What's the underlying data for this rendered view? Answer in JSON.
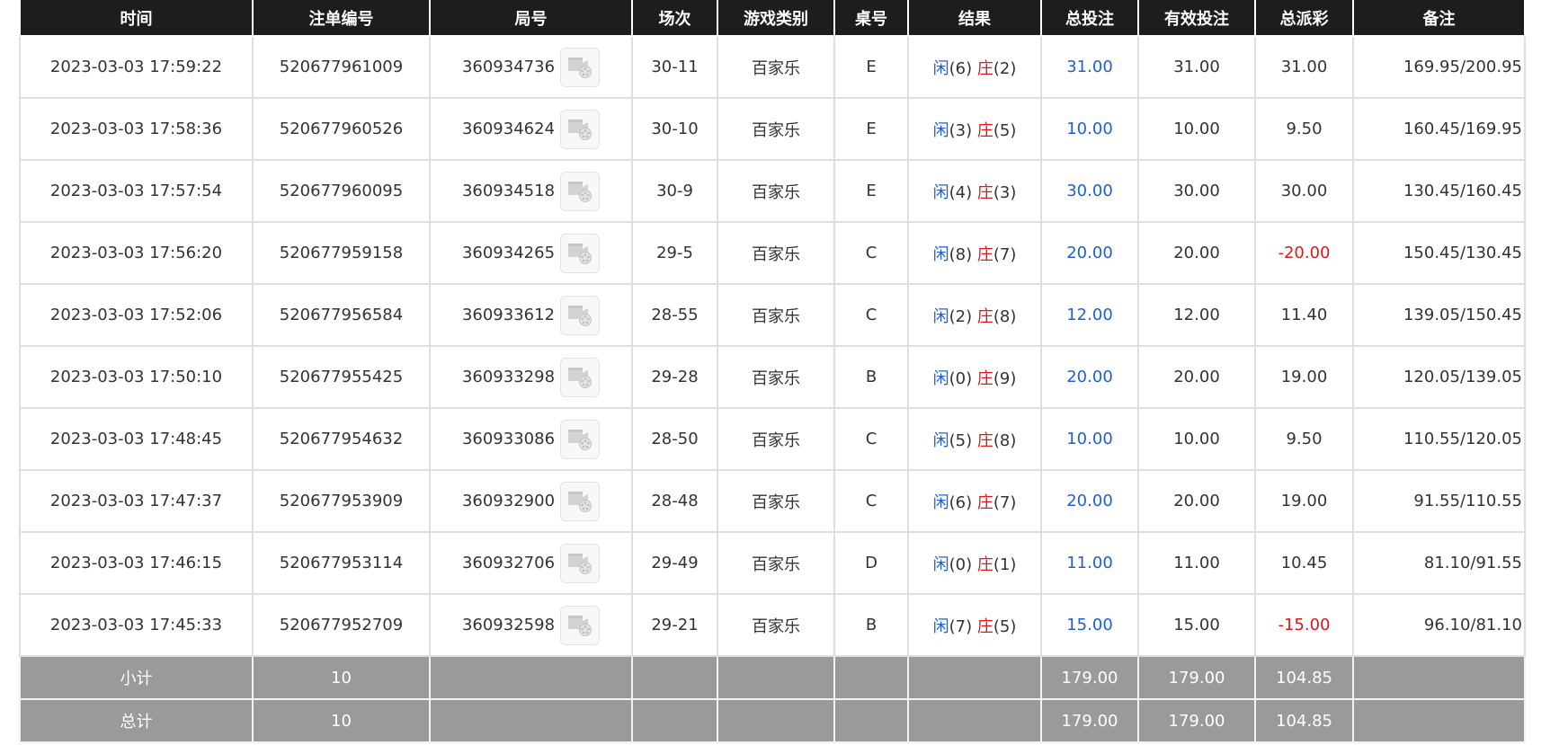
{
  "headers": [
    "时间",
    "注单编号",
    "局号",
    "场次",
    "游戏类别",
    "桌号",
    "结果",
    "总投注",
    "有效投注",
    "总派彩",
    "备注"
  ],
  "rows": [
    {
      "time": "2023-03-03 17:59:22",
      "bet_id": "520677961009",
      "round": "360934736",
      "session": "30-11",
      "game": "百家乐",
      "table": "E",
      "player_label": "闲",
      "player_pt": "(6)",
      "banker_label": "庄",
      "banker_pt": "(2)",
      "total_bet": "31.00",
      "valid_bet": "31.00",
      "payout": "31.00",
      "payout_negative": false,
      "remark": "169.95/200.95"
    },
    {
      "time": "2023-03-03 17:58:36",
      "bet_id": "520677960526",
      "round": "360934624",
      "session": "30-10",
      "game": "百家乐",
      "table": "E",
      "player_label": "闲",
      "player_pt": "(3)",
      "banker_label": "庄",
      "banker_pt": "(5)",
      "total_bet": "10.00",
      "valid_bet": "10.00",
      "payout": "9.50",
      "payout_negative": false,
      "remark": "160.45/169.95"
    },
    {
      "time": "2023-03-03 17:57:54",
      "bet_id": "520677960095",
      "round": "360934518",
      "session": "30-9",
      "game": "百家乐",
      "table": "E",
      "player_label": "闲",
      "player_pt": "(4)",
      "banker_label": "庄",
      "banker_pt": "(3)",
      "total_bet": "30.00",
      "valid_bet": "30.00",
      "payout": "30.00",
      "payout_negative": false,
      "remark": "130.45/160.45"
    },
    {
      "time": "2023-03-03 17:56:20",
      "bet_id": "520677959158",
      "round": "360934265",
      "session": "29-5",
      "game": "百家乐",
      "table": "C",
      "player_label": "闲",
      "player_pt": "(8)",
      "banker_label": "庄",
      "banker_pt": "(7)",
      "total_bet": "20.00",
      "valid_bet": "20.00",
      "payout": "-20.00",
      "payout_negative": true,
      "remark": "150.45/130.45"
    },
    {
      "time": "2023-03-03 17:52:06",
      "bet_id": "520677956584",
      "round": "360933612",
      "session": "28-55",
      "game": "百家乐",
      "table": "C",
      "player_label": "闲",
      "player_pt": "(2)",
      "banker_label": "庄",
      "banker_pt": "(8)",
      "total_bet": "12.00",
      "valid_bet": "12.00",
      "payout": "11.40",
      "payout_negative": false,
      "remark": "139.05/150.45"
    },
    {
      "time": "2023-03-03 17:50:10",
      "bet_id": "520677955425",
      "round": "360933298",
      "session": "29-28",
      "game": "百家乐",
      "table": "B",
      "player_label": "闲",
      "player_pt": "(0)",
      "banker_label": "庄",
      "banker_pt": "(9)",
      "total_bet": "20.00",
      "valid_bet": "20.00",
      "payout": "19.00",
      "payout_negative": false,
      "remark": "120.05/139.05"
    },
    {
      "time": "2023-03-03 17:48:45",
      "bet_id": "520677954632",
      "round": "360933086",
      "session": "28-50",
      "game": "百家乐",
      "table": "C",
      "player_label": "闲",
      "player_pt": "(5)",
      "banker_label": "庄",
      "banker_pt": "(8)",
      "total_bet": "10.00",
      "valid_bet": "10.00",
      "payout": "9.50",
      "payout_negative": false,
      "remark": "110.55/120.05"
    },
    {
      "time": "2023-03-03 17:47:37",
      "bet_id": "520677953909",
      "round": "360932900",
      "session": "28-48",
      "game": "百家乐",
      "table": "C",
      "player_label": "闲",
      "player_pt": "(6)",
      "banker_label": "庄",
      "banker_pt": "(7)",
      "total_bet": "20.00",
      "valid_bet": "20.00",
      "payout": "19.00",
      "payout_negative": false,
      "remark": "91.55/110.55"
    },
    {
      "time": "2023-03-03 17:46:15",
      "bet_id": "520677953114",
      "round": "360932706",
      "session": "29-49",
      "game": "百家乐",
      "table": "D",
      "player_label": "闲",
      "player_pt": "(0)",
      "banker_label": "庄",
      "banker_pt": "(1)",
      "total_bet": "11.00",
      "valid_bet": "11.00",
      "payout": "10.45",
      "payout_negative": false,
      "remark": "81.10/91.55"
    },
    {
      "time": "2023-03-03 17:45:33",
      "bet_id": "520677952709",
      "round": "360932598",
      "session": "29-21",
      "game": "百家乐",
      "table": "B",
      "player_label": "闲",
      "player_pt": "(7)",
      "banker_label": "庄",
      "banker_pt": "(5)",
      "total_bet": "15.00",
      "valid_bet": "15.00",
      "payout": "-15.00",
      "payout_negative": true,
      "remark": "96.10/81.10"
    }
  ],
  "subtotal": {
    "label": "小计",
    "count": "10",
    "total_bet": "179.00",
    "valid_bet": "179.00",
    "payout": "104.85"
  },
  "total": {
    "label": "总计",
    "count": "10",
    "total_bet": "179.00",
    "valid_bet": "179.00",
    "payout": "104.85"
  },
  "colors": {
    "header_bg": "#1d1d1d",
    "footer_bg": "#9a9a9a",
    "player": "#1f5fd6",
    "banker": "#e01818",
    "negative": "#e01818"
  },
  "icons": {
    "replay": "video-replay-icon"
  }
}
